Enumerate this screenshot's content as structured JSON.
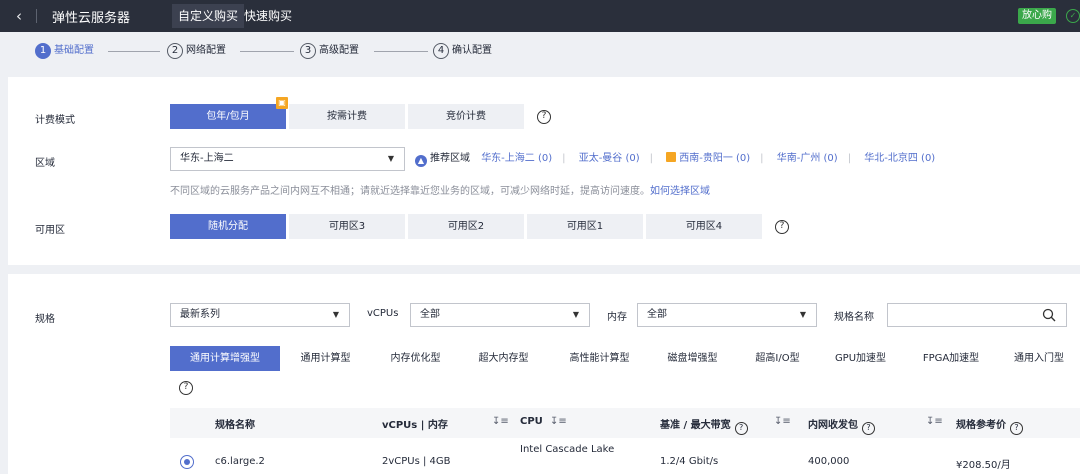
{
  "topbar": {
    "back_icon": "chevron-left-icon",
    "title": "弹性云服务器",
    "tabs": [
      "自定义购买",
      "快速购买"
    ],
    "badge": "放心购"
  },
  "steps": [
    {
      "num": "1",
      "label": "基础配置"
    },
    {
      "num": "2",
      "label": "网络配置"
    },
    {
      "num": "3",
      "label": "高级配置"
    },
    {
      "num": "4",
      "label": "确认配置"
    }
  ],
  "billing": {
    "label": "计费模式",
    "options": [
      "包年/包月",
      "按需计费",
      "竞价计费"
    ],
    "selected": "包年/包月",
    "help": "?"
  },
  "region": {
    "label": "区域",
    "value": "华东-上海二",
    "recommend_label": "推荐区域",
    "links": [
      "华东-上海二 (0)",
      "亚太-曼谷 (0)",
      "西南-贵阳一 (0)",
      "华南-广州 (0)",
      "华北-北京四 (0)"
    ],
    "hint": "不同区域的云服务产品之间内网互不相通；请就近选择靠近您业务的区域，可减少网络时延，提高访问速度。",
    "hint_link": "如何选择区域"
  },
  "az": {
    "label": "可用区",
    "options": [
      "随机分配",
      "可用区3",
      "可用区2",
      "可用区1",
      "可用区4"
    ],
    "selected": "随机分配",
    "help": "?"
  },
  "spec": {
    "label": "规格",
    "series_value": "最新系列",
    "vcpus_label": "vCPUs",
    "vcpus_value": "全部",
    "memory_label": "内存",
    "memory_value": "全部",
    "name_label": "规格名称",
    "name_placeholder": "",
    "types": [
      "通用计算增强型",
      "通用计算型",
      "内存优化型",
      "超大内存型",
      "高性能计算型",
      "磁盘增强型",
      "超高I/O型",
      "GPU加速型",
      "FPGA加速型",
      "通用入门型"
    ],
    "selected_type": "通用计算增强型",
    "help": "?",
    "columns": [
      "规格名称",
      "vCPUs | 内存",
      "CPU",
      "基准 / 最大带宽",
      "内网收发包",
      "规格参考价"
    ],
    "rows": [
      {
        "name": "c6.large.2",
        "vcpus_mem": "2vCPUs | 4GB",
        "cpu": "Intel Cascade Lake",
        "bandwidth": "1.2/4 Gbit/s",
        "pps": "400,000",
        "price": "¥208.50/月"
      }
    ]
  }
}
